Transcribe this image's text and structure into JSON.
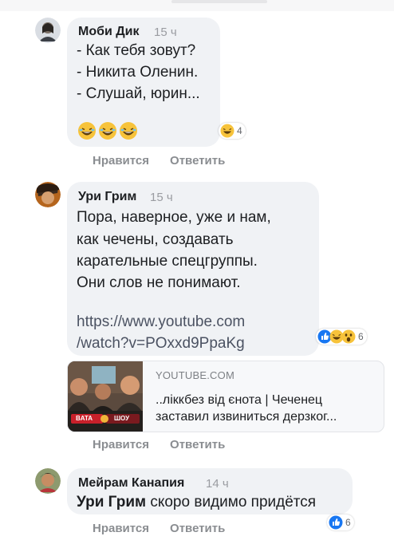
{
  "comments": [
    {
      "author": "Моби Дик",
      "time": "15 ч",
      "lines": [
        "- Как тебя зовут?",
        "- Никита Оленин.",
        "- Слушай, юрин..."
      ],
      "reaction_count": "4",
      "actions": [
        "Нравится",
        "Ответить"
      ]
    },
    {
      "author": "Ури Грим",
      "time": "15 ч",
      "lines": [
        "Пора, наверное, уже и нам,",
        "как чечены, создавать",
        "карательные спецгруппы.",
        "Они слов не понимают."
      ],
      "link_lines": [
        "https://www.youtube.com",
        "/watch?v=POxxd9PpaKg"
      ],
      "reaction_count": "6",
      "preview": {
        "domain": "YOUTUBE.COM",
        "title": "..лiккбез вiд єнота | Чеченец заставил извиниться дерзког...",
        "thumb_badge_left": "BATA",
        "thumb_badge_right": "ШОУ"
      },
      "actions": [
        "Нравится",
        "Ответить"
      ]
    },
    {
      "author": "Мейрам Канапия",
      "time": "14 ч",
      "mention": "Ури Грим",
      "text": " скоро видимо придётся",
      "reaction_count": "6",
      "actions": [
        "Нравится",
        "Ответить"
      ]
    }
  ],
  "reaction_icons": [
    "haha-icon",
    "like-icon",
    "wow-icon"
  ],
  "colors": {
    "bubble": "#f0f2f5",
    "like_blue": "#1877f2",
    "emoji_yellow": "#f7c33b",
    "meta_gray": "#8a8d91"
  }
}
